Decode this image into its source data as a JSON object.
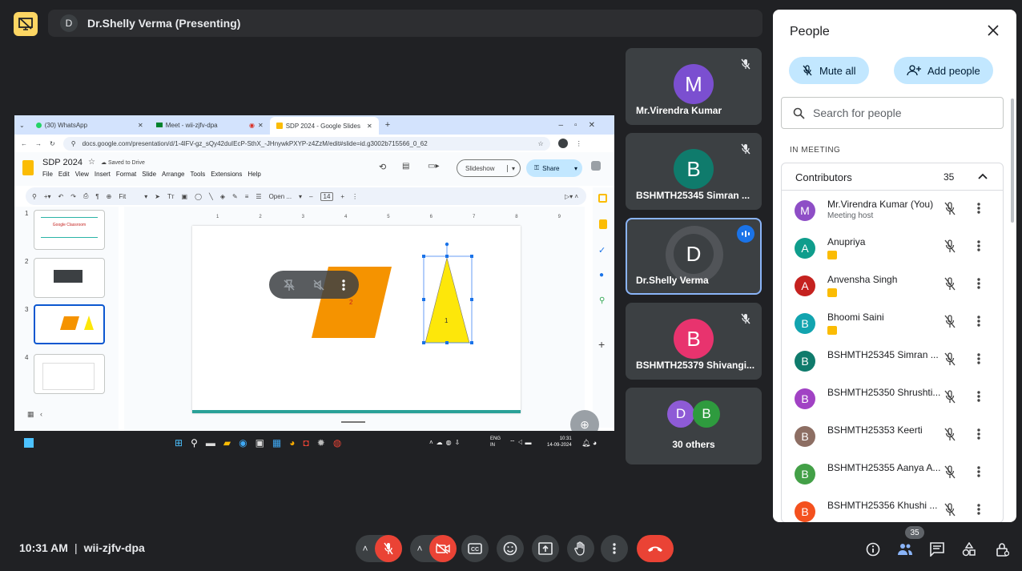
{
  "presenter": {
    "avatar_letter": "D",
    "label": "Dr.Shelly Verma (Presenting)"
  },
  "browser": {
    "tabs": [
      {
        "label": "(30) WhatsApp"
      },
      {
        "label": "Meet - wii-zjfv-dpa"
      },
      {
        "label": "SDP 2024 - Google Slides"
      }
    ],
    "new_tab": "+",
    "url": "docs.google.com/presentation/d/1-4lFV-gz_sQy42duIEcP-SthX_-JHnywkPXYP-z4ZzM/edit#slide=id.g3002b715566_0_62"
  },
  "slides_app": {
    "doc_title": "SDP 2024",
    "saved": "Saved to Drive",
    "menus": [
      "File",
      "Edit",
      "View",
      "Insert",
      "Format",
      "Slide",
      "Arrange",
      "Tools",
      "Extensions",
      "Help"
    ],
    "slideshow_label": "Slideshow",
    "share_label": "Share",
    "zoom_label": "Fit",
    "font_label": "Open ...",
    "font_size": "14",
    "thumbnail_numbers": [
      "1",
      "2",
      "3",
      "4"
    ],
    "thumb1_title": "Google Classroom",
    "shape_label_parallelogram": "2",
    "shape_label_triangle": "1",
    "ruler_numbers": [
      "1",
      "2",
      "3",
      "4",
      "5",
      "6",
      "7",
      "8",
      "9"
    ]
  },
  "windows_taskbar": {
    "lang": "ENG",
    "lang2": "IN",
    "clock_time": "10:31",
    "clock_date": "14-09-2024"
  },
  "tiles": [
    {
      "letter": "M",
      "name": "Mr.Virendra Kumar",
      "color": "#7b4fd0"
    },
    {
      "letter": "B",
      "name": "BSHMTH25345 Simran ...",
      "color": "#0f7b6c"
    },
    {
      "letter": "D",
      "name": "Dr.Shelly Verma",
      "color": "#3c4043"
    },
    {
      "letter": "B",
      "name": "BSHMTH25379 Shivangi...",
      "color": "#e8336e"
    },
    {
      "letters": [
        "D",
        "B"
      ],
      "name": "30 others",
      "colors": [
        "#8e5bd6",
        "#2e9b3e"
      ]
    }
  ],
  "people_panel": {
    "title": "People",
    "mute_all": "Mute all",
    "add_people": "Add people",
    "search_placeholder": "Search for people",
    "section": "IN MEETING",
    "group": "Contributors",
    "count": "35",
    "people": [
      {
        "letter": "M",
        "name": "Mr.Virendra Kumar (You)",
        "sub": "Meeting host",
        "color": "#8e4ec6",
        "badge": false
      },
      {
        "letter": "A",
        "name": "Anupriya",
        "sub": "",
        "color": "#0f9d8c",
        "badge": true
      },
      {
        "letter": "A",
        "name": "Anvensha Singh",
        "sub": "",
        "color": "#c5221f",
        "badge": true
      },
      {
        "letter": "B",
        "name": "Bhoomi Saini",
        "sub": "",
        "color": "#12a4af",
        "badge": true
      },
      {
        "letter": "B",
        "name": "BSHMTH25345 Simran ...",
        "sub": "",
        "color": "#0f7b6c",
        "badge": false
      },
      {
        "letter": "B",
        "name": "BSHMTH25350 Shrushti...",
        "sub": "",
        "color": "#a142c4",
        "badge": false
      },
      {
        "letter": "B",
        "name": "BSHMTH25353 Keerti",
        "sub": "",
        "color": "#8d6e63",
        "badge": false
      },
      {
        "letter": "B",
        "name": "BSHMTH25355 Aanya A...",
        "sub": "",
        "color": "#43a047",
        "badge": false
      },
      {
        "letter": "B",
        "name": "BSHMTH25356 Khushi ...",
        "sub": "",
        "color": "#f4511e",
        "badge": false
      }
    ]
  },
  "bottom": {
    "time": "10:31 AM",
    "separator": "|",
    "code": "wii-zjfv-dpa",
    "people_badge": "35"
  },
  "colors": {
    "accent_red": "#ea4335",
    "accent_blue": "#c2e7ff",
    "parallelogram": "#f59300",
    "triangle": "#fde70a"
  }
}
